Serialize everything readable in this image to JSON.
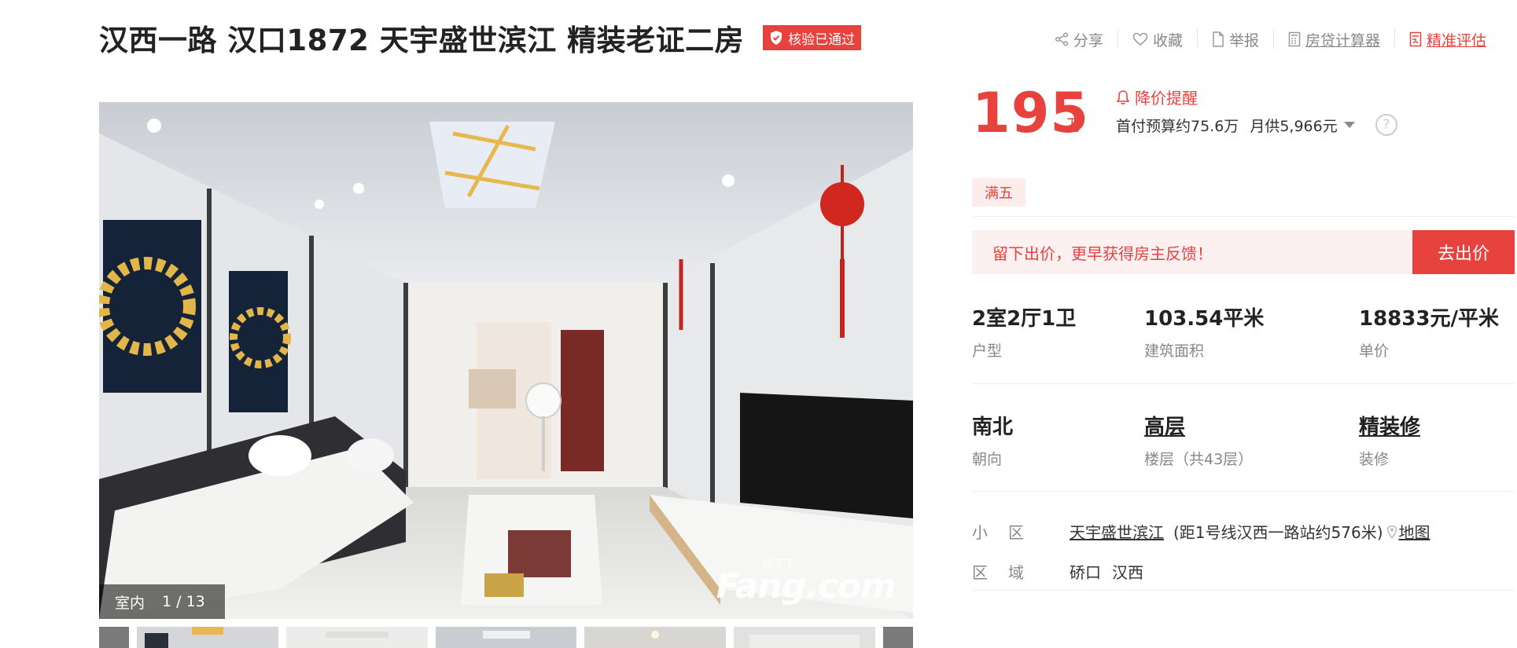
{
  "header": {
    "title": "汉西一路 汉口1872 天宇盛世滨江 精装老证二房",
    "badge": "核验已通过",
    "actions": {
      "share": "分享",
      "favorite": "收藏",
      "report": "举报",
      "mortgage_calc": "房贷计算器",
      "evaluate": "精准评估"
    }
  },
  "gallery": {
    "category": "室内",
    "counter": "1 / 13",
    "watermark": "Fang.com",
    "watermark_cn": "房天下"
  },
  "price": {
    "total": "195",
    "unit": "万",
    "alert": "降价提醒",
    "down_payment": "首付预算约75.6万",
    "monthly": "月供5,966元",
    "help": "?"
  },
  "tags": [
    "满五"
  ],
  "offer": {
    "prompt": "留下出价，更早获得房主反馈！",
    "button": "去出价"
  },
  "attributes": [
    {
      "value": "2室2厅1卫",
      "label": "户型"
    },
    {
      "value": "103.54平米",
      "label": "建筑面积"
    },
    {
      "value": "18833元/平米",
      "label": "单价"
    },
    {
      "value": "南北",
      "label": "朝向"
    },
    {
      "value": "高层",
      "label": "楼层（共43层）"
    },
    {
      "value": "精装修",
      "label": "装修"
    }
  ],
  "community": {
    "label": "小区",
    "name": "天宇盛世滨江",
    "distance": "(距1号线汉西一路站约576米)",
    "map": "地图"
  },
  "district": {
    "label": "区域",
    "area1": "硚口",
    "area2": "汉西"
  },
  "colors": {
    "accent": "#e8423f",
    "tag_bg": "#fdecec",
    "offer_bg": "#fdf0f0"
  }
}
